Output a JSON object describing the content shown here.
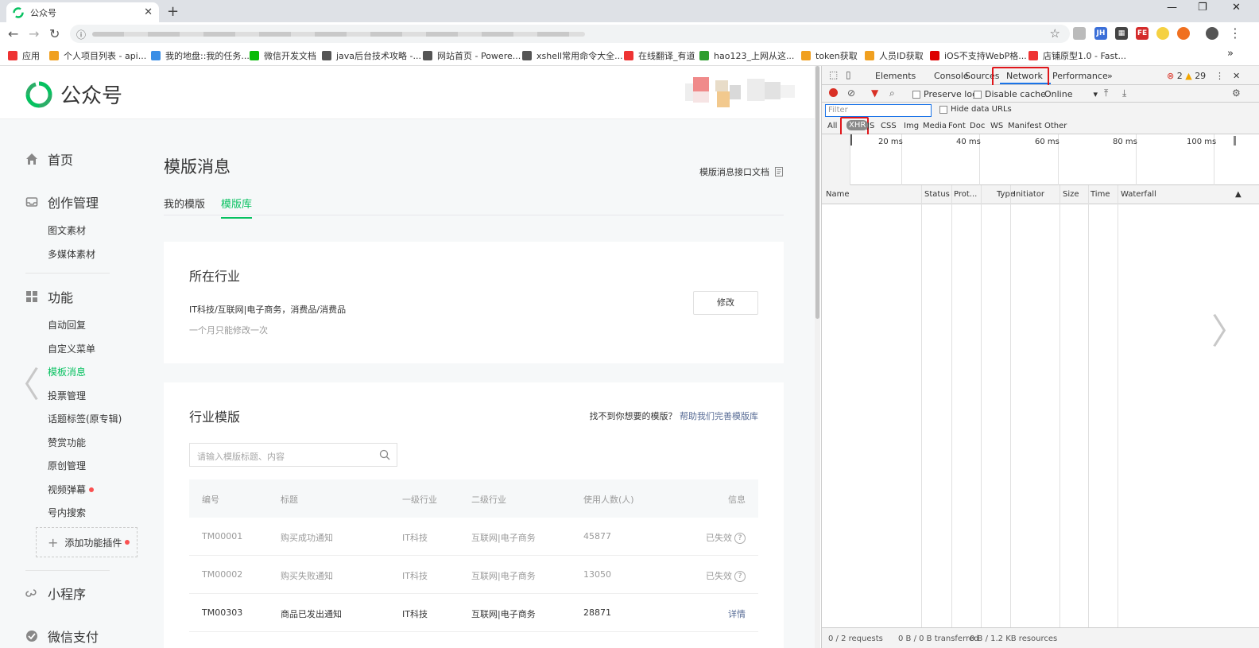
{
  "browser": {
    "tab_title": "公众号",
    "newtab_symbol": "+",
    "close_symbol": "✕",
    "window_min": "—",
    "window_restore": "❐",
    "window_close": "✕"
  },
  "bookmarks": [
    {
      "label": "应用",
      "color": "#e33"
    },
    {
      "label": "个人项目列表 - api...",
      "color": "#f0a020"
    },
    {
      "label": "我的地盘::我的任务...",
      "color": "#3a8ee6"
    },
    {
      "label": "微信开发文档",
      "color": "#09bb07"
    },
    {
      "label": "java后台技术攻略 -...",
      "color": "#555"
    },
    {
      "label": "网站首页 - Powere...",
      "color": "#555"
    },
    {
      "label": "xshell常用命令大全...",
      "color": "#555"
    },
    {
      "label": "在线翻译_有道",
      "color": "#e33"
    },
    {
      "label": "hao123_上网从这...",
      "color": "#2e9e2e"
    },
    {
      "label": "token获取",
      "color": "#f0a020"
    },
    {
      "label": "人员ID获取",
      "color": "#f0a020"
    },
    {
      "label": "iOS不支持WebP格...",
      "color": "#d00"
    },
    {
      "label": "店铺原型1.0 - Fast...",
      "color": "#e33"
    }
  ],
  "bookmarks_overflow": "»",
  "header": {
    "logo_text": "公众号",
    "brand_color": "#07c160"
  },
  "sidebar": {
    "home": "首页",
    "create": "创作管理",
    "create_items": [
      "图文素材",
      "多媒体素材"
    ],
    "features": "功能",
    "feature_items": [
      "自动回复",
      "自定义菜单",
      "模板消息",
      "投票管理",
      "话题标签(原专辑)",
      "赞赏功能",
      "原创管理",
      "视频弹幕",
      "号内搜索"
    ],
    "active_item": "模板消息",
    "add_plugin": "添加功能插件",
    "miniprogram": "小程序",
    "wxpay": "微信支付"
  },
  "main": {
    "title": "模版消息",
    "doc_link": "模版消息接口文档",
    "tabs": [
      "我的模版",
      "模版库"
    ],
    "active_tab": "模版库",
    "industry": {
      "heading": "所在行业",
      "value": "IT科技/互联网|电子商务，消费品/消费品",
      "hint": "一个月只能修改一次",
      "edit_button": "修改"
    },
    "templates": {
      "heading": "行业模版",
      "helper_text": "找不到你想要的模版？",
      "helper_link": "帮助我们完善模版库",
      "search_placeholder": "请输入模版标题、内容",
      "columns": [
        "编号",
        "标题",
        "一级行业",
        "二级行业",
        "使用人数(人)",
        "信息"
      ],
      "rows": [
        {
          "id": "TM00001",
          "title": "购买成功通知",
          "l1": "IT科技",
          "l2": "互联网|电子商务",
          "users": "45877",
          "info": "已失效"
        },
        {
          "id": "TM00002",
          "title": "购买失败通知",
          "l1": "IT科技",
          "l2": "互联网|电子商务",
          "users": "13050",
          "info": "已失效"
        },
        {
          "id": "TM00303",
          "title": "商品已发出通知",
          "l1": "IT科技",
          "l2": "互联网|电子商务",
          "users": "28871",
          "info": "详情"
        }
      ]
    }
  },
  "devtools": {
    "tabs": [
      "Elements",
      "Console",
      "Sources",
      "Network",
      "Performance"
    ],
    "more_tabs": "»",
    "active_tab": "Network",
    "errors": "2",
    "warnings": "29",
    "preserve_log": "Preserve log",
    "disable_cache": "Disable cache",
    "throttle": "Online",
    "filter_placeholder": "Filter",
    "hide_data_urls": "Hide data URLs",
    "types": [
      "All",
      "XHR",
      "JS",
      "CSS",
      "Img",
      "Media",
      "Font",
      "Doc",
      "WS",
      "Manifest",
      "Other"
    ],
    "active_type": "XHR",
    "timeline_ticks": [
      "20 ms",
      "40 ms",
      "60 ms",
      "80 ms",
      "100 ms"
    ],
    "columns": [
      "Name",
      "Status",
      "Prot...",
      "Type",
      "Initiator",
      "Size",
      "Time",
      "Waterfall"
    ],
    "status_requests": "0 / 2 requests",
    "status_transferred": "0 B / 0 B transferred",
    "status_resources": "0 B / 1.2 KB resources"
  }
}
